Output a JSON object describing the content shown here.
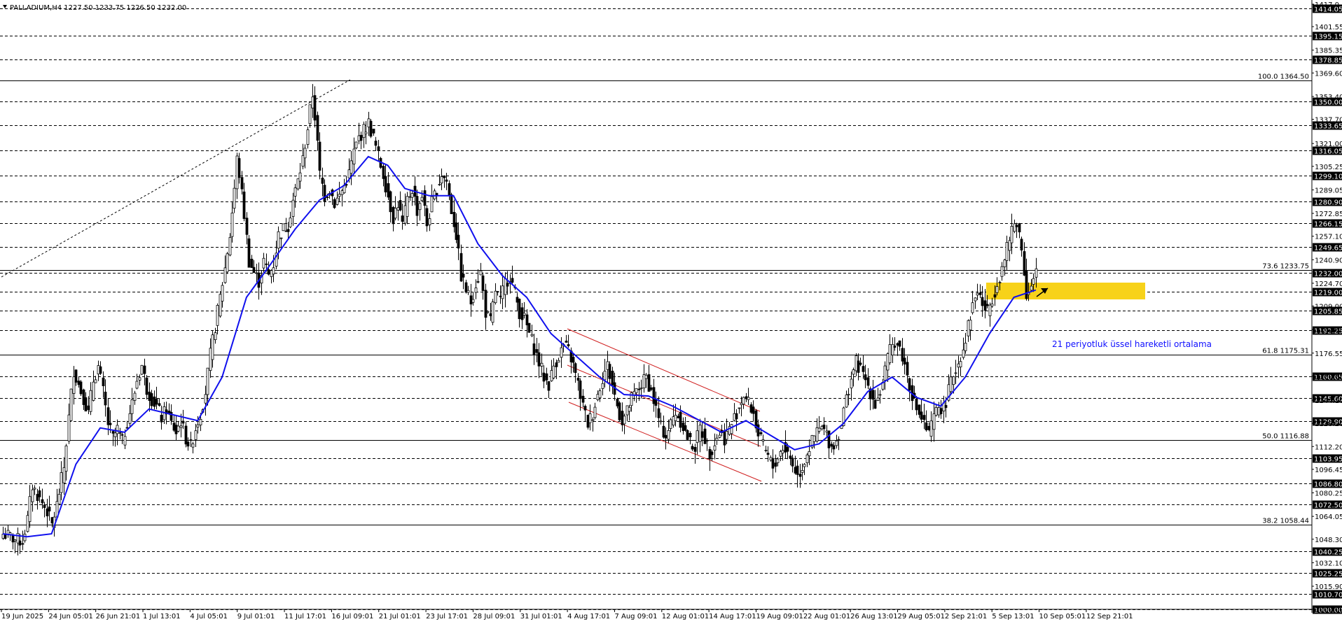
{
  "chart_data": {
    "type": "candlestick",
    "title": "PALLADIUM,H4  1227.50 1233.75 1226.50 1232.00",
    "symbol": "PALLADIUM",
    "timeframe": "H4",
    "ohlc_header": {
      "open": 1227.5,
      "high": 1233.75,
      "low": 1226.5,
      "close": 1232.0
    },
    "ylim": [
      1000.0,
      1417.0
    ],
    "y_tick_labels": [
      "1417.0",
      "1401.55",
      "1385.35",
      "1369.60",
      "1353.40",
      "1337.70",
      "1321.00",
      "1305.25",
      "1289.05",
      "1272.85",
      "1257.10",
      "1240.90",
      "1224.70",
      "1209.00",
      "1192.80",
      "1176.55",
      "1160.65",
      "1144.10",
      "1128.20",
      "1112.20",
      "1096.45",
      "1080.25",
      "1064.05",
      "1048.30",
      "1032.10",
      "1015.90",
      "1000.00"
    ],
    "horizontal_levels": [
      1414.05,
      1395.15,
      1378.85,
      1350.0,
      1333.65,
      1316.05,
      1299.1,
      1280.9,
      1266.15,
      1249.65,
      1232.0,
      1219.0,
      1205.85,
      1192.25,
      1160.65,
      1145.6,
      1129.9,
      1103.95,
      1086.8,
      1072.5,
      1040.25,
      1025.25,
      1010.7,
      1000.0
    ],
    "highlighted_price_labels": [
      "1414.05",
      "1395.15",
      "1378.85",
      "1350.00",
      "1333.65",
      "1316.05",
      "1299.10",
      "1280.90",
      "1266.15",
      "1249.65",
      "1232.00",
      "1219.00",
      "1205.85",
      "1192.25",
      "1160.65",
      "1145.60",
      "1129.90",
      "1103.95",
      "1086.80",
      "1072.50",
      "1040.25",
      "1025.25",
      "1010.70",
      "1000.00"
    ],
    "fibonacci_levels": [
      {
        "label": "100.0 1364.50",
        "value": 1364.5
      },
      {
        "label": "73.6 1233.75",
        "value": 1233.75
      },
      {
        "label": "61.8 1175.31",
        "value": 1175.31
      },
      {
        "label": "50.0 1116.88",
        "value": 1116.88
      },
      {
        "label": "38.2 1058.44",
        "value": 1058.44
      }
    ],
    "x_tick_labels": [
      "19 Jun 2025",
      "24 Jun 05:01",
      "26 Jun 21:01",
      "1 Jul 13:01",
      "4 Jul 05:01",
      "9 Jul 01:01",
      "11 Jul 17:01",
      "16 Jul 09:01",
      "21 Jul 01:01",
      "23 Jul 17:01",
      "28 Jul 09:01",
      "31 Jul 01:01",
      "4 Aug 17:01",
      "7 Aug 09:01",
      "12 Aug 01:01",
      "14 Aug 17:01",
      "19 Aug 09:01",
      "22 Aug 01:01",
      "26 Aug 13:01",
      "29 Aug 05:01",
      "2 Sep 21:01",
      "5 Sep 13:01",
      "10 Sep 05:01",
      "12 Sep 21:01"
    ],
    "close_path": [
      [
        0,
        1052
      ],
      [
        3,
        1050
      ],
      [
        5,
        1048
      ],
      [
        8,
        1047
      ],
      [
        10,
        1062
      ],
      [
        12,
        1085
      ],
      [
        15,
        1076
      ],
      [
        18,
        1068
      ],
      [
        20,
        1058
      ],
      [
        22,
        1072
      ],
      [
        25,
        1098
      ],
      [
        27,
        1132
      ],
      [
        29,
        1165
      ],
      [
        31,
        1155
      ],
      [
        33,
        1146
      ],
      [
        35,
        1135
      ],
      [
        37,
        1158
      ],
      [
        39,
        1167
      ],
      [
        41,
        1150
      ],
      [
        43,
        1128
      ],
      [
        45,
        1118
      ],
      [
        47,
        1124
      ],
      [
        49,
        1115
      ],
      [
        51,
        1130
      ],
      [
        53,
        1142
      ],
      [
        55,
        1158
      ],
      [
        57,
        1168
      ],
      [
        59,
        1152
      ],
      [
        61,
        1145
      ],
      [
        63,
        1140
      ],
      [
        65,
        1132
      ],
      [
        67,
        1138
      ],
      [
        69,
        1128
      ],
      [
        71,
        1122
      ],
      [
        73,
        1130
      ],
      [
        75,
        1118
      ],
      [
        77,
        1112
      ],
      [
        79,
        1125
      ],
      [
        81,
        1135
      ],
      [
        83,
        1150
      ],
      [
        85,
        1175
      ],
      [
        87,
        1195
      ],
      [
        89,
        1215
      ],
      [
        91,
        1235
      ],
      [
        93,
        1258
      ],
      [
        95,
        1290
      ],
      [
        96,
        1310
      ],
      [
        97,
        1300
      ],
      [
        99,
        1272
      ],
      [
        101,
        1240
      ],
      [
        103,
        1232
      ],
      [
        105,
        1226
      ],
      [
        107,
        1240
      ],
      [
        109,
        1230
      ],
      [
        111,
        1238
      ],
      [
        113,
        1258
      ],
      [
        115,
        1262
      ],
      [
        117,
        1265
      ],
      [
        119,
        1282
      ],
      [
        121,
        1295
      ],
      [
        123,
        1310
      ],
      [
        125,
        1332
      ],
      [
        127,
        1355
      ],
      [
        128,
        1340
      ],
      [
        130,
        1300
      ],
      [
        132,
        1285
      ],
      [
        134,
        1290
      ],
      [
        136,
        1280
      ],
      [
        138,
        1285
      ],
      [
        140,
        1292
      ],
      [
        142,
        1300
      ],
      [
        144,
        1315
      ],
      [
        146,
        1325
      ],
      [
        148,
        1330
      ],
      [
        150,
        1335
      ],
      [
        152,
        1325
      ],
      [
        154,
        1312
      ],
      [
        156,
        1300
      ],
      [
        158,
        1285
      ],
      [
        160,
        1270
      ],
      [
        162,
        1280
      ],
      [
        164,
        1265
      ],
      [
        166,
        1282
      ],
      [
        168,
        1290
      ],
      [
        170,
        1275
      ],
      [
        172,
        1286
      ],
      [
        174,
        1265
      ],
      [
        176,
        1280
      ],
      [
        178,
        1290
      ],
      [
        180,
        1300
      ],
      [
        182,
        1295
      ],
      [
        184,
        1275
      ],
      [
        186,
        1258
      ],
      [
        188,
        1230
      ],
      [
        190,
        1220
      ],
      [
        192,
        1212
      ],
      [
        194,
        1225
      ],
      [
        196,
        1232
      ],
      [
        198,
        1205
      ],
      [
        200,
        1198
      ],
      [
        202,
        1220
      ],
      [
        204,
        1212
      ],
      [
        206,
        1225
      ],
      [
        208,
        1230
      ],
      [
        210,
        1218
      ],
      [
        212,
        1205
      ],
      [
        214,
        1200
      ],
      [
        216,
        1190
      ],
      [
        218,
        1180
      ],
      [
        220,
        1170
      ],
      [
        222,
        1160
      ],
      [
        224,
        1155
      ],
      [
        226,
        1168
      ],
      [
        228,
        1175
      ],
      [
        230,
        1182
      ],
      [
        232,
        1178
      ],
      [
        234,
        1168
      ],
      [
        236,
        1155
      ],
      [
        238,
        1140
      ],
      [
        240,
        1128
      ],
      [
        242,
        1135
      ],
      [
        244,
        1148
      ],
      [
        246,
        1160
      ],
      [
        248,
        1168
      ],
      [
        250,
        1155
      ],
      [
        252,
        1140
      ],
      [
        254,
        1130
      ],
      [
        256,
        1136
      ],
      [
        258,
        1145
      ],
      [
        260,
        1150
      ],
      [
        262,
        1155
      ],
      [
        264,
        1160
      ],
      [
        266,
        1150
      ],
      [
        268,
        1138
      ],
      [
        270,
        1125
      ],
      [
        272,
        1120
      ],
      [
        274,
        1128
      ],
      [
        276,
        1136
      ],
      [
        278,
        1130
      ],
      [
        280,
        1122
      ],
      [
        282,
        1115
      ],
      [
        284,
        1112
      ],
      [
        286,
        1125
      ],
      [
        288,
        1118
      ],
      [
        290,
        1108
      ],
      [
        292,
        1115
      ],
      [
        294,
        1122
      ],
      [
        296,
        1118
      ],
      [
        298,
        1124
      ],
      [
        300,
        1132
      ],
      [
        302,
        1140
      ],
      [
        304,
        1148
      ],
      [
        306,
        1142
      ],
      [
        308,
        1135
      ],
      [
        310,
        1120
      ],
      [
        312,
        1112
      ],
      [
        314,
        1105
      ],
      [
        316,
        1098
      ],
      [
        318,
        1105
      ],
      [
        320,
        1112
      ],
      [
        322,
        1108
      ],
      [
        324,
        1100
      ],
      [
        326,
        1092
      ],
      [
        328,
        1098
      ],
      [
        330,
        1108
      ],
      [
        332,
        1115
      ],
      [
        334,
        1122
      ],
      [
        336,
        1125
      ],
      [
        338,
        1120
      ],
      [
        340,
        1112
      ],
      [
        342,
        1116
      ],
      [
        344,
        1128
      ],
      [
        346,
        1145
      ],
      [
        348,
        1160
      ],
      [
        350,
        1170
      ],
      [
        352,
        1165
      ],
      [
        354,
        1158
      ],
      [
        356,
        1150
      ],
      [
        358,
        1142
      ],
      [
        360,
        1150
      ],
      [
        362,
        1165
      ],
      [
        364,
        1178
      ],
      [
        366,
        1185
      ],
      [
        368,
        1180
      ],
      [
        370,
        1168
      ],
      [
        372,
        1155
      ],
      [
        374,
        1142
      ],
      [
        376,
        1135
      ],
      [
        378,
        1128
      ],
      [
        380,
        1120
      ],
      [
        382,
        1132
      ],
      [
        384,
        1140
      ],
      [
        386,
        1138
      ],
      [
        388,
        1150
      ],
      [
        390,
        1162
      ],
      [
        392,
        1170
      ],
      [
        394,
        1180
      ],
      [
        396,
        1195
      ],
      [
        398,
        1210
      ],
      [
        400,
        1220
      ],
      [
        402,
        1210
      ],
      [
        404,
        1205
      ],
      [
        406,
        1215
      ],
      [
        408,
        1225
      ],
      [
        410,
        1235
      ],
      [
        412,
        1248
      ],
      [
        414,
        1262
      ],
      [
        416,
        1268
      ],
      [
        418,
        1248
      ],
      [
        420,
        1218
      ],
      [
        422,
        1222
      ],
      [
        424,
        1232
      ]
    ],
    "ema_path": [
      [
        0,
        1052
      ],
      [
        10,
        1050
      ],
      [
        20,
        1052
      ],
      [
        30,
        1100
      ],
      [
        40,
        1125
      ],
      [
        50,
        1122
      ],
      [
        60,
        1138
      ],
      [
        70,
        1134
      ],
      [
        80,
        1130
      ],
      [
        90,
        1160
      ],
      [
        100,
        1215
      ],
      [
        110,
        1238
      ],
      [
        120,
        1262
      ],
      [
        130,
        1282
      ],
      [
        140,
        1292
      ],
      [
        150,
        1312
      ],
      [
        158,
        1306
      ],
      [
        165,
        1290
      ],
      [
        175,
        1285
      ],
      [
        185,
        1285
      ],
      [
        195,
        1252
      ],
      [
        205,
        1230
      ],
      [
        215,
        1215
      ],
      [
        225,
        1190
      ],
      [
        235,
        1175
      ],
      [
        245,
        1160
      ],
      [
        255,
        1148
      ],
      [
        265,
        1147
      ],
      [
        275,
        1140
      ],
      [
        285,
        1131
      ],
      [
        295,
        1122
      ],
      [
        305,
        1130
      ],
      [
        315,
        1120
      ],
      [
        325,
        1110
      ],
      [
        335,
        1114
      ],
      [
        345,
        1128
      ],
      [
        355,
        1150
      ],
      [
        365,
        1160
      ],
      [
        375,
        1146
      ],
      [
        385,
        1140
      ],
      [
        395,
        1160
      ],
      [
        405,
        1190
      ],
      [
        415,
        1215
      ],
      [
        424,
        1220
      ]
    ],
    "bar_count": 425,
    "annotation": "21 periyotluk üssel hareketli ortalama",
    "grid": false
  }
}
